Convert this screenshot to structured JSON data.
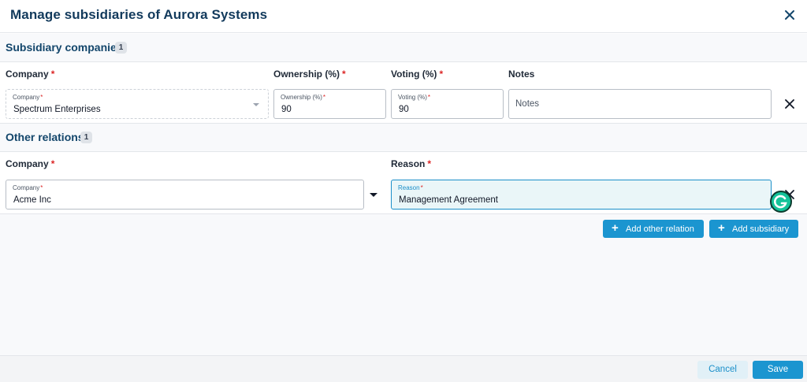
{
  "dialog": {
    "title": "Manage subsidiaries of Aurora Systems"
  },
  "subsidiaries": {
    "title": "Subsidiary companies",
    "count": "1",
    "columns": {
      "company": "Company",
      "ownership": "Ownership (%)",
      "voting": "Voting (%)",
      "notes": "Notes"
    },
    "required_mark": "*",
    "row": {
      "company_label": "Company",
      "company_value": "Spectrum Enterprises",
      "ownership_label": "Ownership (%)",
      "ownership_value": "90",
      "voting_label": "Voting (%)",
      "voting_value": "90",
      "notes_placeholder": "Notes"
    }
  },
  "other_relations": {
    "title": "Other relations",
    "count": "1",
    "columns": {
      "company": "Company",
      "reason": "Reason"
    },
    "row": {
      "company_label": "Company",
      "company_value": "Acme Inc",
      "reason_label": "Reason",
      "reason_value": "Management Agreement"
    }
  },
  "actions": {
    "add_other_relation": "Add other relation",
    "add_subsidiary": "Add subsidiary"
  },
  "footer": {
    "cancel": "Cancel",
    "save": "Save"
  },
  "colors": {
    "primary": "#1b95d0",
    "title": "#123a5c",
    "required": "#dc2626",
    "focus_bg": "#eaf6f8"
  },
  "icons": {
    "close": "close-icon",
    "remove_row": "close-icon",
    "dropdown": "chevron-down-icon",
    "add": "plus-icon",
    "grammarly": "grammarly-icon"
  }
}
